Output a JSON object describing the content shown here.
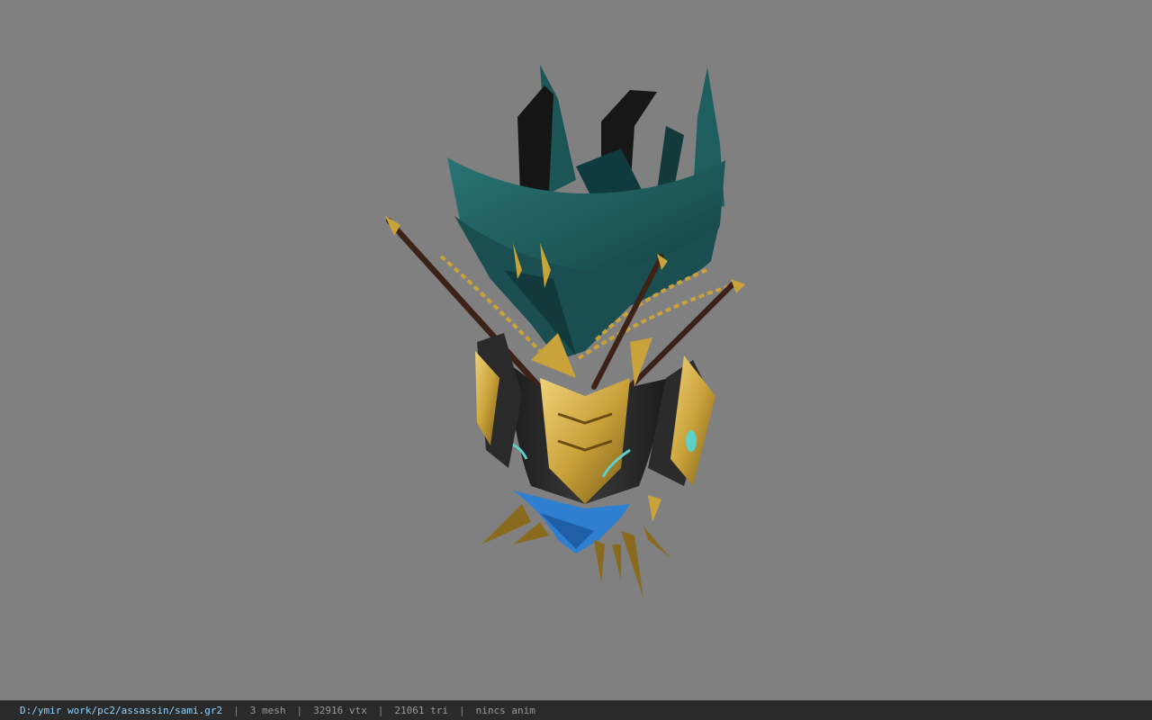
{
  "viewer": {
    "background": "#808080"
  },
  "statusbar": {
    "file_path": "D:/ymir work/pc2/assassin/sami.gr2",
    "separator": "|",
    "mesh_count": "3 mesh",
    "vertex_count": "32916 vtx",
    "triangle_count": "21061 tri",
    "anim_status": "nincs anim",
    "path_color": "#8fd3ff"
  },
  "model": {
    "icon": "3d-character-model",
    "colors": {
      "cloth": "#1f5a5a",
      "cloth_dark": "#143d3e",
      "gold": "#c9a23a",
      "gold_dark": "#8a6a1e",
      "body": "#2b2b2b",
      "blue": "#2f7fd0",
      "spear": "#4a2a1e"
    }
  }
}
